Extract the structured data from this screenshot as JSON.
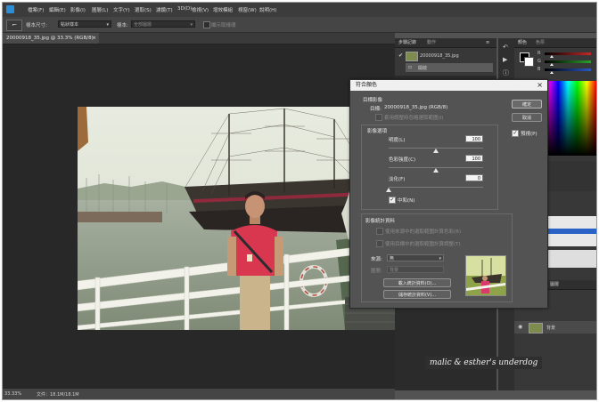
{
  "menu": {
    "items": [
      "檔案(F)",
      "編輯(E)",
      "影像(I)",
      "圖層(L)",
      "文字(Y)",
      "選取(S)",
      "濾鏡(T)",
      "3D(D)",
      "檢視(V)",
      "增效模組",
      "視窗(W)",
      "說明(H)"
    ]
  },
  "options_bar": {
    "tool_icon": "⌐",
    "sample_size_label": "樣本尺寸:",
    "sample_size_value": "點狀樣本",
    "sample_label": "樣本:",
    "sample_value": "全部圖層",
    "show_ring_label": "顯示取樣環"
  },
  "document": {
    "tab_label": "20000918_35.jpg @ 33.3% (RGB/8)",
    "tab_close": "×",
    "zoom": "33.33%",
    "doc_size": "文件：18.1M/18.1M"
  },
  "history_panel": {
    "tabs": [
      "步驟記錄",
      "動作"
    ],
    "snapshot_label": "20000918_35.jpg",
    "step_label": "開啟"
  },
  "color_panel": {
    "tabs": [
      "顏色",
      "色票"
    ],
    "sliders": [
      {
        "name": "R",
        "color": "#c82828",
        "value": 0.15
      },
      {
        "name": "G",
        "color": "#2ca02c",
        "value": 0.15
      },
      {
        "name": "B",
        "color": "#2858c8",
        "value": 0.15
      }
    ]
  },
  "layers_panel": {
    "tab": "圖層",
    "layer_name": "背景"
  },
  "dialog": {
    "title": "符合顏色",
    "close": "×",
    "target_heading": "目標影像",
    "target_label": "目標:",
    "target_value": "20000918_35.jpg (RGB/8)",
    "ignore_selection": "套用調整時忽略選取範圍(I)",
    "options_heading": "影像選項",
    "luminance_label": "明度(L)",
    "luminance_value": "100",
    "luminance_pos": 0.5,
    "intensity_label": "色彩強度(C)",
    "intensity_value": "100",
    "intensity_pos": 0.5,
    "fade_label": "淡化(F)",
    "fade_value": "0",
    "fade_pos": 0,
    "neutralize_label": "中和(N)",
    "stats_heading": "影像統計資料",
    "use_selection_source": "使用來源中的選取範圍計算色彩(R)",
    "use_selection_target": "使用目標中的選取範圍計算調整(T)",
    "source_label": "來源:",
    "source_value": "無",
    "layer_label": "圖層:",
    "layer_value": "背景",
    "load_stats": "載入統計資料(O)...",
    "save_stats": "儲存統計資料(V)...",
    "ok_button": "確定",
    "cancel_button": "取消",
    "preview_label": "預視(P)"
  },
  "watermark": {
    "text": "malic & esther's underdog"
  }
}
